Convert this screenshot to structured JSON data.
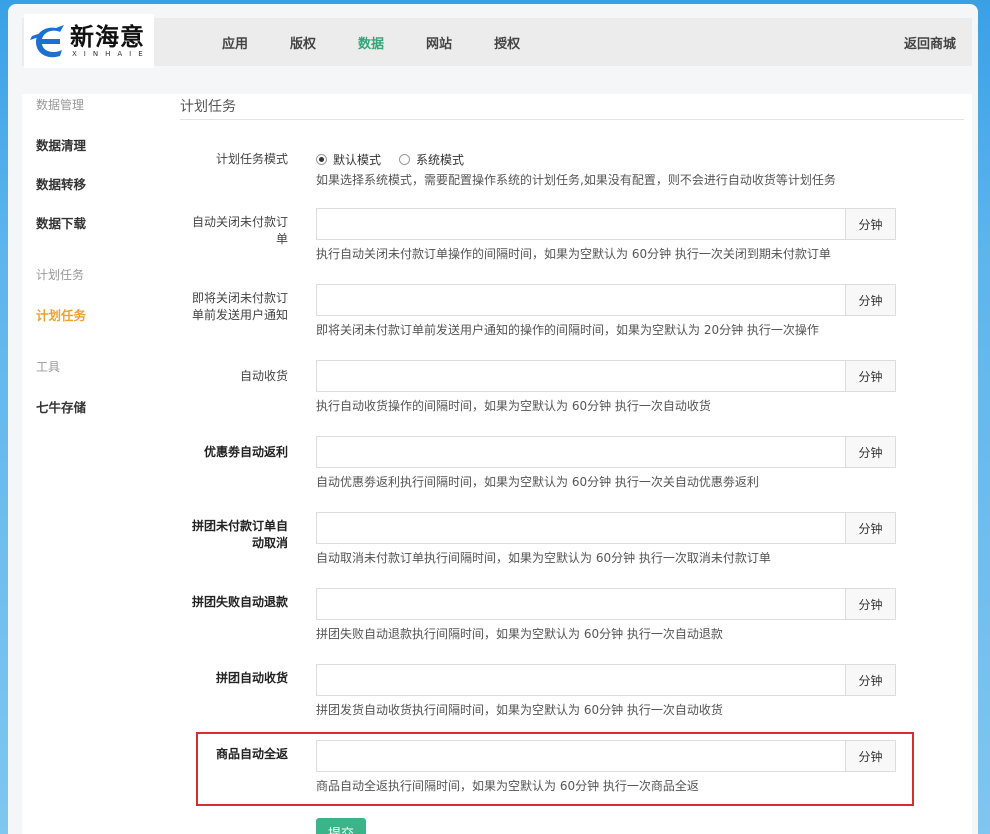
{
  "brand": {
    "name_cn": "新海意",
    "name_en": "XINHAIE"
  },
  "nav": {
    "items": [
      {
        "label": "应用",
        "active": false
      },
      {
        "label": "版权",
        "active": false
      },
      {
        "label": "数据",
        "active": true
      },
      {
        "label": "网站",
        "active": false
      },
      {
        "label": "授权",
        "active": false
      }
    ],
    "back_label": "返回商城"
  },
  "sidebar": {
    "groups": [
      {
        "title": "数据管理",
        "items": [
          "数据清理",
          "数据转移",
          "数据下载"
        ]
      },
      {
        "title": "计划任务",
        "items": [
          "计划任务"
        ]
      },
      {
        "title": "工具",
        "items": [
          "七牛存储"
        ]
      }
    ],
    "active_item": "计划任务"
  },
  "page": {
    "title": "计划任务"
  },
  "form": {
    "mode": {
      "label": "计划任务模式",
      "options": [
        "默认模式",
        "系统模式"
      ],
      "selected": "默认模式",
      "help": "如果选择系统模式，需要配置操作系统的计划任务,如果没有配置，则不会进行自动收货等计划任务"
    },
    "rows": [
      {
        "label_line1": "自动关闭未付款订",
        "label_line2": "单",
        "unit": "分钟",
        "value": "",
        "help": "执行自动关闭未付款订单操作的间隔时间，如果为空默认为 60分钟 执行一次关闭到期未付款订单"
      },
      {
        "label_line1": "即将关闭未付款订",
        "label_line2": "单前发送用户通知",
        "unit": "分钟",
        "value": "",
        "help": "即将关闭未付款订单前发送用户通知的操作的间隔时间，如果为空默认为 20分钟 执行一次操作"
      },
      {
        "label_line1": "自动收货",
        "label_line2": "",
        "unit": "分钟",
        "value": "",
        "help": "执行自动收货操作的间隔时间，如果为空默认为 60分钟 执行一次自动收货"
      },
      {
        "label_line1": "优惠劵自动返利",
        "label_line2": "",
        "unit": "分钟",
        "value": "",
        "help": "自动优惠劵返利执行间隔时间，如果为空默认为 60分钟 执行一次关自动优惠劵返利"
      },
      {
        "label_line1": "拼团未付款订单自",
        "label_line2": "动取消",
        "unit": "分钟",
        "value": "",
        "help": "自动取消未付款订单执行间隔时间，如果为空默认为 60分钟 执行一次取消未付款订单"
      },
      {
        "label_line1": "拼团失败自动退款",
        "label_line2": "",
        "unit": "分钟",
        "value": "",
        "help": "拼团失败自动退款执行间隔时间，如果为空默认为 60分钟 执行一次自动退款"
      },
      {
        "label_line1": "拼团自动收货",
        "label_line2": "",
        "unit": "分钟",
        "value": "",
        "help": "拼团发货自动收货执行间隔时间，如果为空默认为 60分钟 执行一次自动收货"
      },
      {
        "label_line1": "商品自动全返",
        "label_line2": "",
        "unit": "分钟",
        "value": "",
        "help": "商品自动全返执行间隔时间，如果为空默认为 60分钟 执行一次商品全返"
      }
    ],
    "submit_label": "提交"
  },
  "colors": {
    "accent": "#35a57a",
    "sidebar_active": "#f0a030",
    "highlight": "#d32f2f",
    "button": "#3bb48a"
  }
}
